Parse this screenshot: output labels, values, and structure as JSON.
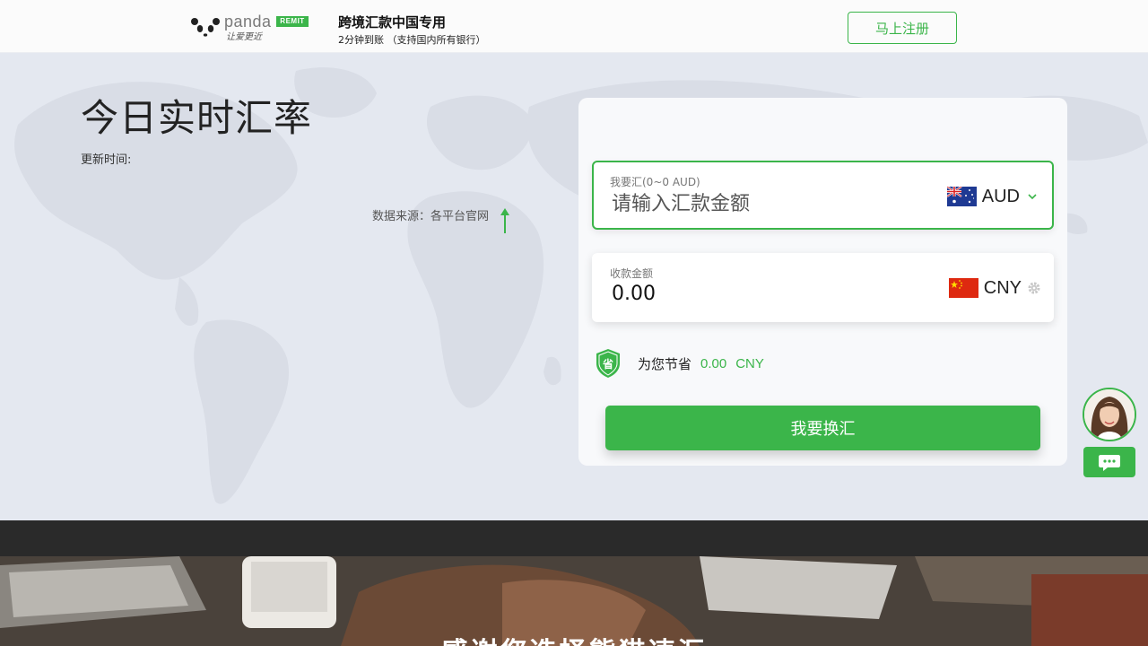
{
  "header": {
    "logo_word": "panda",
    "logo_badge": "REMIT",
    "logo_script": "让爱更近",
    "title": "跨境汇款中国专用",
    "subtitle": "2分钟到账 （支持国内所有银行）",
    "register_label": "马上注册"
  },
  "hero": {
    "title": "今日实时汇率",
    "update_time": "更新时间:",
    "data_source": "数据来源：各平台官网"
  },
  "calculator": {
    "send": {
      "label": "我要汇(0~0 AUD)",
      "placeholder": "请输入汇款金额",
      "currency": "AUD",
      "flag_icon": "australia-flag-icon"
    },
    "receive": {
      "label": "收款金额",
      "amount": "0.00",
      "currency": "CNY",
      "flag_icon": "china-flag-icon"
    },
    "savings": {
      "label": "为您节省",
      "amount": "0.00",
      "currency": "CNY"
    },
    "exchange_label": "我要换汇"
  },
  "footer_band": {
    "thanks": "感谢您选择熊猫速汇"
  },
  "colors": {
    "brand_green": "#3bb54a",
    "hero_bg": "#e4e8f0",
    "dark_band": "#2a2a2a"
  }
}
